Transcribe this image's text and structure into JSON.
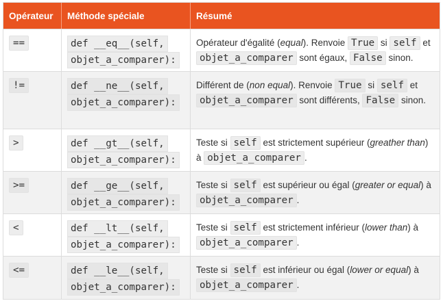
{
  "headers": [
    "Opérateur",
    "Méthode spéciale",
    "Résumé"
  ],
  "rows": [
    {
      "op": "==",
      "m1": "def __eq__(self,",
      "m2": "objet_a_comparer):",
      "s": [
        "Opérateur d'égalité (",
        "equal",
        "). Renvoie ",
        "True",
        " si ",
        "self",
        " et ",
        "objet_a_comparer",
        " sont égaux, ",
        "False",
        " sinon."
      ]
    },
    {
      "op": "!=",
      "m1": "def __ne__(self,",
      "m2": "objet_a_comparer):",
      "s": [
        "Différent de (",
        "non equal",
        "). Renvoie ",
        "True",
        " si ",
        "self",
        " et ",
        "objet_a_comparer",
        " sont différents, ",
        "False",
        " sinon."
      ]
    },
    {
      "op": ">",
      "m1": "def __gt__(self,",
      "m2": "objet_a_comparer):",
      "s": [
        "Teste si ",
        "self",
        " est strictement supérieur (",
        "greather than",
        ") à ",
        "objet_a_comparer",
        "."
      ]
    },
    {
      "op": ">=",
      "m1": "def __ge__(self,",
      "m2": "objet_a_comparer):",
      "s": [
        "Teste si ",
        "self",
        " est supérieur ou égal (",
        "greater or equal",
        ") à ",
        "objet_a_comparer",
        "."
      ]
    },
    {
      "op": "<",
      "m1": "def __lt__(self,",
      "m2": "objet_a_comparer):",
      "s": [
        "Teste si ",
        "self",
        " est strictement inférieur (",
        "lower than",
        ") à ",
        "objet_a_comparer",
        "."
      ]
    },
    {
      "op": "<=",
      "m1": "def __le__(self,",
      "m2": "objet_a_comparer):",
      "s": [
        "Teste si ",
        "self",
        " est inférieur ou égal (",
        "lower or equal",
        ") à ",
        "objet_a_comparer",
        "."
      ]
    }
  ]
}
